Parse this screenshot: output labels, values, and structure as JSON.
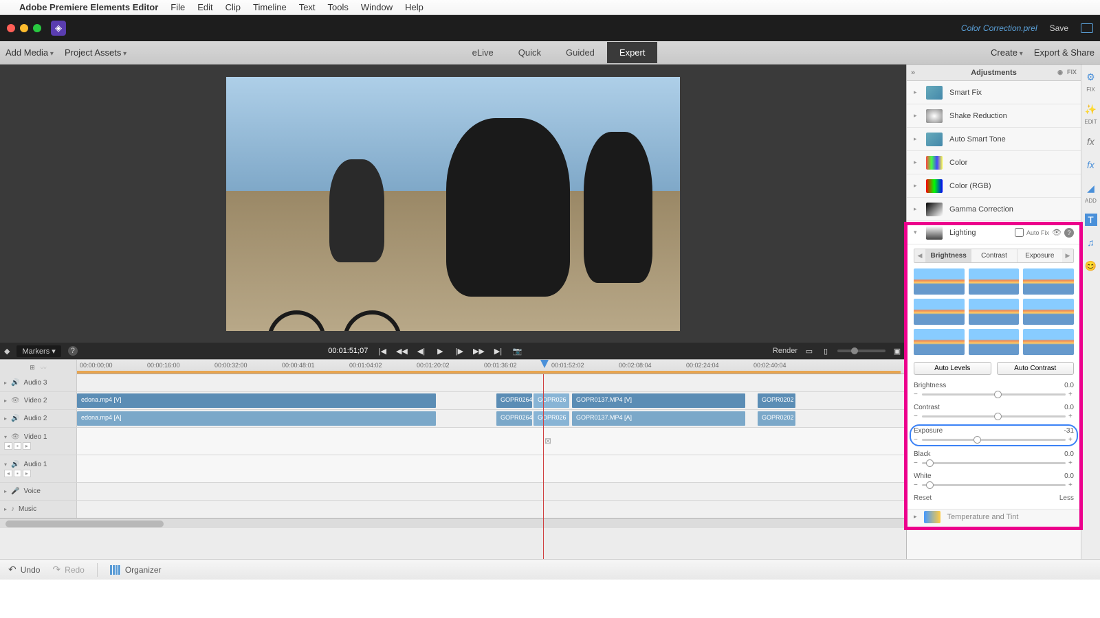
{
  "menubar": {
    "app": "Adobe Premiere Elements Editor",
    "items": [
      "File",
      "Edit",
      "Clip",
      "Timeline",
      "Text",
      "Tools",
      "Window",
      "Help"
    ]
  },
  "titlebar": {
    "doc": "Color Correction.prel",
    "save": "Save"
  },
  "toolbar": {
    "add_media": "Add Media",
    "project_assets": "Project Assets",
    "tabs": {
      "elive": "eLive",
      "quick": "Quick",
      "guided": "Guided",
      "expert": "Expert"
    },
    "create": "Create",
    "export": "Export & Share"
  },
  "transport": {
    "markers": "Markers",
    "timecode": "00:01:51;07",
    "render": "Render"
  },
  "ruler": {
    "ticks": [
      "00:00:00;00",
      "00:00:16:00",
      "00:00:32:00",
      "00:00:48:01",
      "00:01:04:02",
      "00:01:20:02",
      "00:01:36:02",
      "00:01:52:02",
      "00:02:08:04",
      "00:02:24:04",
      "00:02:40:04"
    ]
  },
  "tracks": {
    "audio3": "Audio 3",
    "video2": "Video 2",
    "audio2": "Audio 2",
    "video1": "Video 1",
    "audio1": "Audio 1",
    "voice": "Voice",
    "music": "Music",
    "clips": {
      "v2a": "edona.mp4 [V]",
      "a2a": "edona.mp4 [A]",
      "v2b": "GOPR0264.",
      "v2c": "GOPR026",
      "v2d": "GOPR0137.MP4 [V]",
      "v2e": "GOPR0202",
      "a2b": "GOPR0264.",
      "a2c": "GOPR026",
      "a2d": "GOPR0137.MP4 [A]",
      "a2e": "GOPR0202"
    }
  },
  "adjust": {
    "title": "Adjustments",
    "fix": "FIX",
    "items": {
      "smartfix": "Smart Fix",
      "shake": "Shake Reduction",
      "autosmart": "Auto Smart Tone",
      "color": "Color",
      "colorrgb": "Color (RGB)",
      "gamma": "Gamma Correction",
      "lighting": "Lighting",
      "temptint": "Temperature and Tint"
    },
    "autofix": "Auto Fix",
    "subtabs": {
      "brightness": "Brightness",
      "contrast": "Contrast",
      "exposure": "Exposure"
    },
    "auto_levels": "Auto Levels",
    "auto_contrast": "Auto Contrast",
    "sliders": {
      "brightness": {
        "label": "Brightness",
        "value": "0.0",
        "pos": 50
      },
      "contrast": {
        "label": "Contrast",
        "value": "0.0",
        "pos": 50
      },
      "exposure": {
        "label": "Exposure",
        "value": "-31",
        "pos": 36
      },
      "black": {
        "label": "Black",
        "value": "0.0",
        "pos": 3
      },
      "white": {
        "label": "White",
        "value": "0.0",
        "pos": 3
      }
    },
    "reset": "Reset",
    "less": "Less"
  },
  "rail": {
    "fix": "FIX",
    "edit": "EDIT",
    "add": "ADD"
  },
  "bottom": {
    "undo": "Undo",
    "redo": "Redo",
    "organizer": "Organizer"
  }
}
